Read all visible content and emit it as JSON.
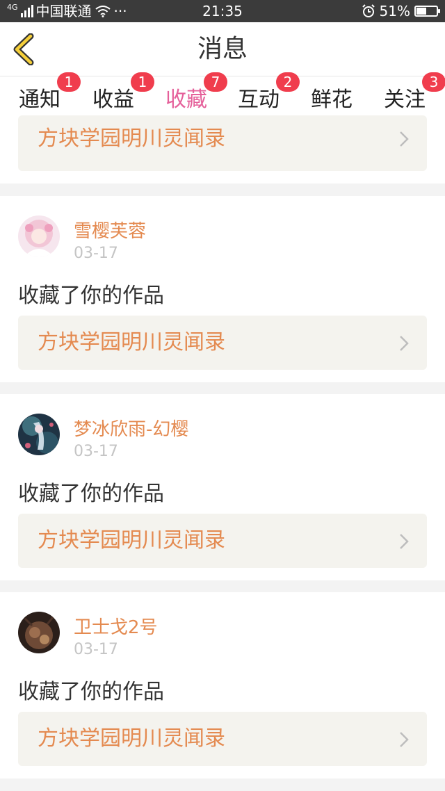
{
  "status_bar": {
    "network": "4G",
    "carrier": "中国联通",
    "more": "···",
    "time": "21:35",
    "battery_percent": "51%",
    "battery_level": 0.51
  },
  "header": {
    "title": "消息",
    "back_icon": "chevron-left-icon",
    "accent_color": "#f5cf3a"
  },
  "tabs": [
    {
      "label": "通知",
      "badge": "1"
    },
    {
      "label": "收益",
      "badge": "1"
    },
    {
      "label": "收藏",
      "badge": "7",
      "active": true
    },
    {
      "label": "互动",
      "badge": "2"
    },
    {
      "label": "鲜花",
      "badge": ""
    },
    {
      "label": "关注",
      "badge": "3"
    }
  ],
  "colors": {
    "active_tab": "#e5609a",
    "badge": "#f03d4d",
    "username": "#e48a50",
    "work_title": "#e48a50",
    "work_bg": "#f4f3ee"
  },
  "partial_card": {
    "work_title": "方块学园明川灵闻录"
  },
  "messages": [
    {
      "username": "雪樱芙蓉",
      "date": "03-17",
      "action": "收藏了你的作品",
      "work_title": "方块学园明川灵闻录"
    },
    {
      "username": "梦冰欣雨-幻樱",
      "date": "03-17",
      "action": "收藏了你的作品",
      "work_title": "方块学园明川灵闻录"
    },
    {
      "username": "卫士戈2号",
      "date": "03-17",
      "action": "收藏了你的作品",
      "work_title": "方块学园明川灵闻录"
    }
  ]
}
